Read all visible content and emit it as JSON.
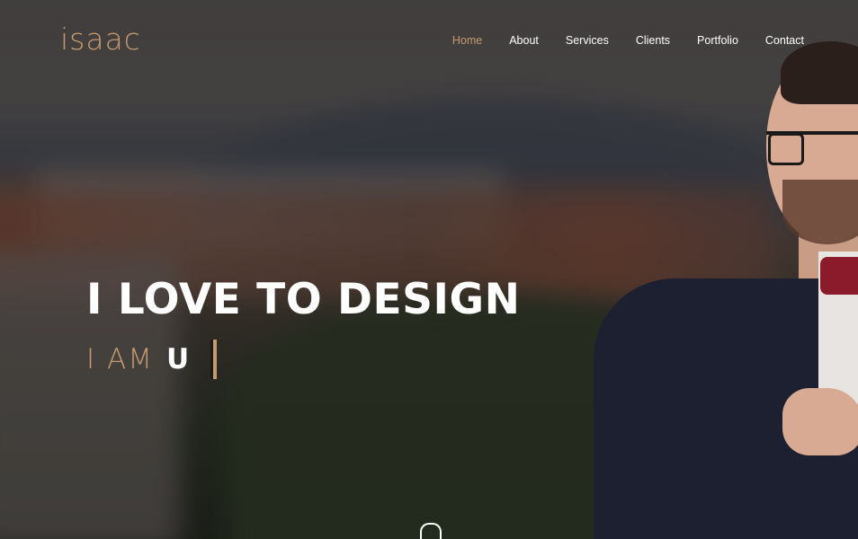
{
  "brand": {
    "logo": "isaac"
  },
  "nav": {
    "items": [
      {
        "label": "Home",
        "active": true
      },
      {
        "label": "About",
        "active": false
      },
      {
        "label": "Services",
        "active": false
      },
      {
        "label": "Clients",
        "active": false
      },
      {
        "label": "Portfolio",
        "active": false
      },
      {
        "label": "Contact",
        "active": false
      }
    ]
  },
  "hero": {
    "headline": "I LOVE TO DESIGN",
    "prefix": "I AM",
    "typed_text": "U"
  },
  "colors": {
    "accent": "#c59a6e",
    "text": "#ffffff",
    "bowtie": "#8b1a2a",
    "suit": "#1c2030"
  },
  "icons": {
    "scroll_indicator": "mouse-icon",
    "text_cursor": "typing-cursor"
  }
}
